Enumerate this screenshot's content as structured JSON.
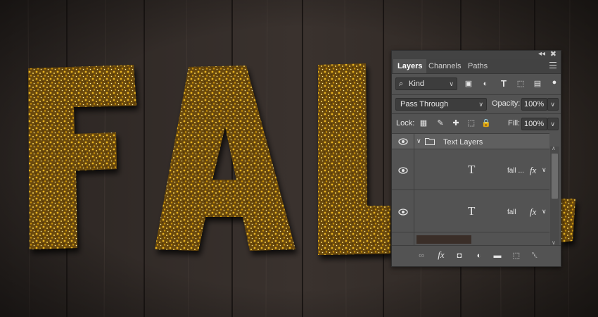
{
  "artwork": {
    "text": "fall",
    "colors": {
      "wood_dark": "#2a2421",
      "wood_mid": "#3b3330",
      "glitter": "#b8860b"
    }
  },
  "panel": {
    "tabs": [
      {
        "label": "Layers"
      },
      {
        "label": "Channels"
      },
      {
        "label": "Paths"
      }
    ],
    "filter": {
      "value": "Kind"
    },
    "blend_mode": {
      "value": "Pass Through"
    },
    "opacity": {
      "label": "Opacity:",
      "value": "100%"
    },
    "lock": {
      "label": "Lock:"
    },
    "fill": {
      "label": "Fill:",
      "value": "100%"
    },
    "group": {
      "name": "Text Layers"
    },
    "layers": [
      {
        "name": "fall ...",
        "fx": "fx"
      },
      {
        "name": "fall",
        "fx": "fx"
      }
    ],
    "footer_icons": [
      "link-icon",
      "fx-icon",
      "mask-icon",
      "adjustment-icon",
      "folder-icon",
      "new-layer-icon",
      "trash-icon"
    ]
  }
}
